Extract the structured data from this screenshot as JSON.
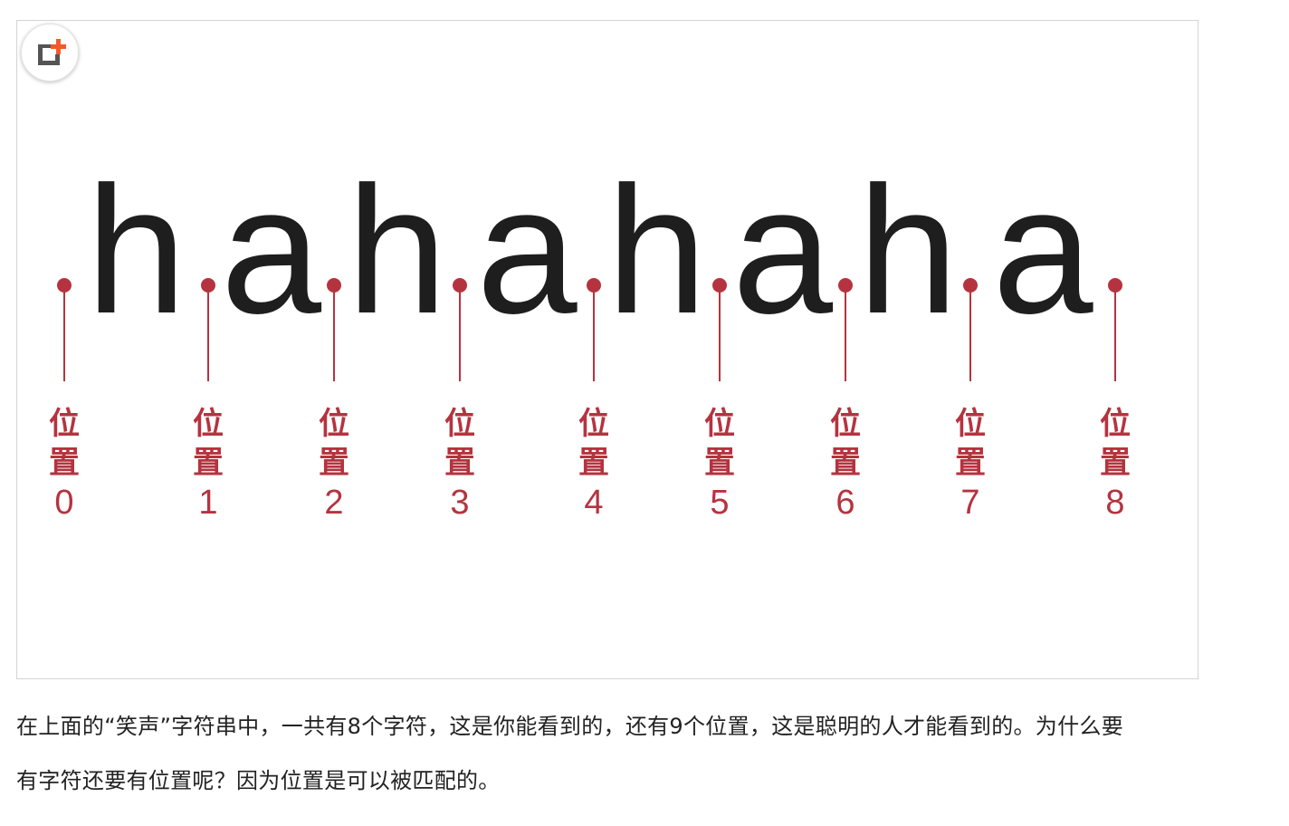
{
  "diagram": {
    "characters": [
      "h",
      "a",
      "h",
      "a",
      "h",
      "a",
      "h",
      "a"
    ],
    "positions": [
      {
        "word": "位置",
        "index": "0"
      },
      {
        "word": "位置",
        "index": "1"
      },
      {
        "word": "位置",
        "index": "2"
      },
      {
        "word": "位置",
        "index": "3"
      },
      {
        "word": "位置",
        "index": "4"
      },
      {
        "word": "位置",
        "index": "5"
      },
      {
        "word": "位置",
        "index": "6"
      },
      {
        "word": "位置",
        "index": "7"
      },
      {
        "word": "位置",
        "index": "8"
      }
    ],
    "colors": {
      "marker": "#b5333f",
      "text": "#1e1e1e",
      "badge_dark": "#555555",
      "badge_accent": "#f25a2c"
    },
    "badge_icon": "add-to-collection-icon"
  },
  "caption": {
    "line1": "在上面的“笑声”字符串中，一共有8个字符，这是你能看到的，还有9个位置，这是聪明的人才能看到的。为什么要",
    "line2": "有字符还要有位置呢？因为位置是可以被匹配的。"
  }
}
